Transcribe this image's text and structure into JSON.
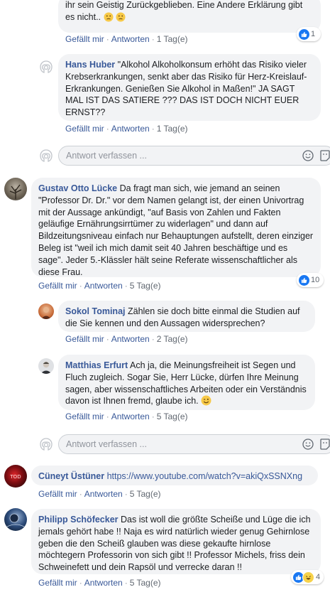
{
  "c0": {
    "text": "ihr sein Geistig Zurückgeblieben. Eine Andere Erklärung gibt es nicht..",
    "like": "Gefällt mir",
    "reply": "Antworten",
    "time": "1 Tag(e)",
    "reactions": "1"
  },
  "c1": {
    "author": "Hans Huber",
    "text": "\"Alkohol Alkoholkonsum erhöht das Risiko vieler Krebserkrankungen, senkt aber das Risiko für Herz-Kreislauf-Erkrankungen. Genießen Sie Alkohol in Maßen!\" JA SAGT MAL IST DAS SATIERE ??? DAS IST DOCH NICHT EUER ERNST??",
    "like": "Gefällt mir",
    "reply": "Antworten",
    "time": "1 Tag(e)"
  },
  "reply_box_1": {
    "placeholder": "Antwort verfassen ..."
  },
  "c2": {
    "author": "Gustav Otto Lücke",
    "text": "Da fragt man sich, wie jemand an seinen \"Professor Dr. Dr.\" vor dem Namen gelangt ist, der einen Univortrag mit der Aussage ankündigt, \"auf Basis von Zahlen und Fakten geläufige Ernährungsirrtümer zu widerlagen\" und dann auf Bildzeitungsniveau einfach nur Behauptungen aufstellt, deren einziger Beleg ist \"weil ich mich damit seit 40 Jahren beschäftige und es sage\". Jeder 5.-Klässler hält seine Referate wissenschaftlicher als diese Frau.",
    "like": "Gefällt mir",
    "reply": "Antworten",
    "time": "5 Tag(e)",
    "reactions": "10"
  },
  "c3": {
    "author": "Sokol Tominaj",
    "text": "Zählen sie doch bitte einmal die Studien auf die Sie kennen und den Aussagen widersprechen?",
    "like": "Gefällt mir",
    "reply": "Antworten",
    "time": "2 Tag(e)"
  },
  "c4": {
    "author": "Matthias Erfurt",
    "text": "Ach ja, die Meinungsfreiheit ist Segen und Fluch zugleich. Sogar Sie, Herr Lücke, dürfen Ihre Meinung sagen, aber wissenschaftliches Arbeiten oder ein Verständnis davon ist Ihnen fremd, glaube ich.",
    "like": "Gefällt mir",
    "reply": "Antworten",
    "time": "5 Tag(e)"
  },
  "reply_box_2": {
    "placeholder": "Antwort verfassen ..."
  },
  "c5": {
    "author": "Cüneyt Üstüner",
    "link": "https://www.youtube.com/watch?v=akiQxSSNXng",
    "like": "Gefällt mir",
    "reply": "Antworten",
    "time": "5 Tag(e)"
  },
  "c6": {
    "author": "Philipp Schöfecker",
    "text": "Das ist woll die größte Scheiße und Lüge die ich jemals gehört habe !! Naja es wird natürlich wieder genug Gehirnlose geben die den Scheiß glauben was diese gekaufte hirnlose möchtegern Professorin von sich gibt !! Professor Michels, friss dein Schweinefett und dein Rapsöl und verrecke daran !!",
    "like": "Gefällt mir",
    "reply": "Antworten",
    "time": "5 Tag(e)",
    "reactions": "4"
  },
  "colors": {
    "link": "#385898",
    "bubble": "#f2f3f5",
    "like": "#1877f2",
    "meta": "#606770"
  },
  "icons": [
    "user-placeholder-icon",
    "smiley-icon",
    "sticker-icon",
    "like-reaction-icon",
    "laugh-reaction-icon",
    "confused-emoji-icon",
    "wink-emoji-icon"
  ]
}
